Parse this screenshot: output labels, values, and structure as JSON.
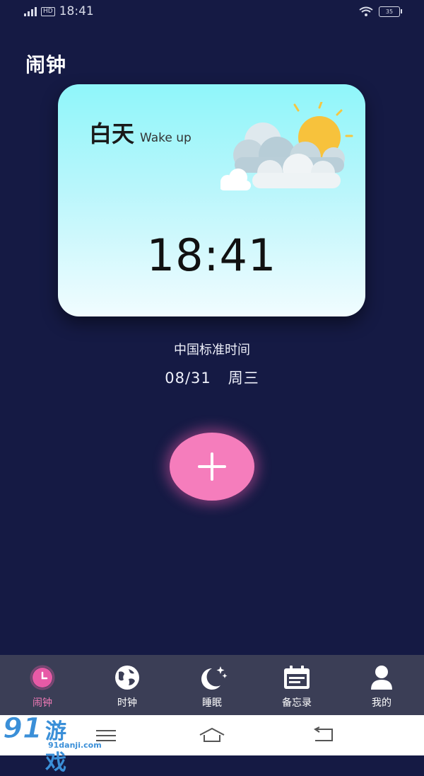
{
  "status_bar": {
    "time": "18:41",
    "battery": "35",
    "network": "5G",
    "hd": "HD"
  },
  "page": {
    "title": "闹钟"
  },
  "card": {
    "period_cn": "白天",
    "period_en": "Wake up",
    "time": "18:41"
  },
  "timezone": {
    "name": "中国标准时间",
    "date": "08/31",
    "weekday": "周三"
  },
  "nav": {
    "items": [
      {
        "label": "闹钟",
        "icon": "alarm-clock-icon",
        "active": true
      },
      {
        "label": "时钟",
        "icon": "globe-icon"
      },
      {
        "label": "睡眠",
        "icon": "moon-stars-icon"
      },
      {
        "label": "备忘录",
        "icon": "calendar-icon"
      },
      {
        "label": "我的",
        "icon": "person-icon"
      }
    ]
  },
  "watermark": {
    "logo": "91",
    "text": "游戏",
    "url": "91danji.com"
  },
  "colors": {
    "background": "#151a44",
    "accent_pink": "#f57dbc",
    "nav_bg": "#3b3e56",
    "card_top": "#8ff6fa"
  }
}
